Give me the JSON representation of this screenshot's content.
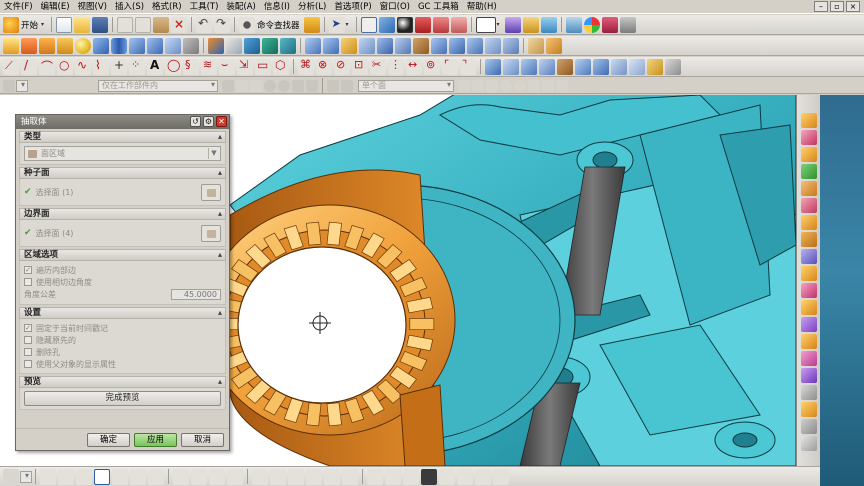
{
  "menu": {
    "items": [
      "文件(F)",
      "编辑(E)",
      "视图(V)",
      "插入(S)",
      "格式(R)",
      "工具(T)",
      "装配(A)",
      "信息(I)",
      "分析(L)",
      "首选项(P)",
      "窗口(O)",
      "GC 工具箱",
      "帮助(H)"
    ]
  },
  "window_controls": {
    "minimize": "–",
    "restore": "▫",
    "close": "×"
  },
  "toolbar1": {
    "start_label": "开始",
    "command_finder_label": "命令查找器"
  },
  "filterbar": {
    "filter_value": "仅在工作部件内",
    "selection_value": "单个面"
  },
  "dialog": {
    "title": "抽取体",
    "title_buttons": {
      "reset": "↺",
      "settings": "⚙",
      "close": "✕"
    },
    "sections": {
      "type": {
        "header": "类型",
        "value": "面区域"
      },
      "seed_face": {
        "header": "种子面",
        "select_label": "选择面 (1)"
      },
      "boundary_face": {
        "header": "边界面",
        "select_label": "选择面 (4)"
      },
      "region_options": {
        "header": "区域选项",
        "checkboxes": [
          {
            "label": "遍历内部边",
            "checked": true
          },
          {
            "label": "使用相切边角度",
            "checked": false
          }
        ],
        "angle_label": "角度公差",
        "angle_value": "45.0000"
      },
      "settings": {
        "header": "设置",
        "checkboxes": [
          {
            "label": "固定于当前时间戳记",
            "checked": true
          },
          {
            "label": "隐藏原先的",
            "checked": false
          },
          {
            "label": "删除孔",
            "checked": false
          },
          {
            "label": "使用父对象的显示属性",
            "checked": false
          }
        ]
      },
      "preview": {
        "header": "预览",
        "button": "完成预览"
      }
    },
    "buttons": {
      "ok": "确定",
      "apply": "应用",
      "cancel": "取消"
    }
  },
  "colors": {
    "part_body": "#3fb5c4",
    "part_dark": "#2a8796",
    "extracted_face": "#f2a43c",
    "extracted_dark": "#c9731c",
    "rod": "#5a5a5a",
    "apply_button": "#79c45a"
  }
}
